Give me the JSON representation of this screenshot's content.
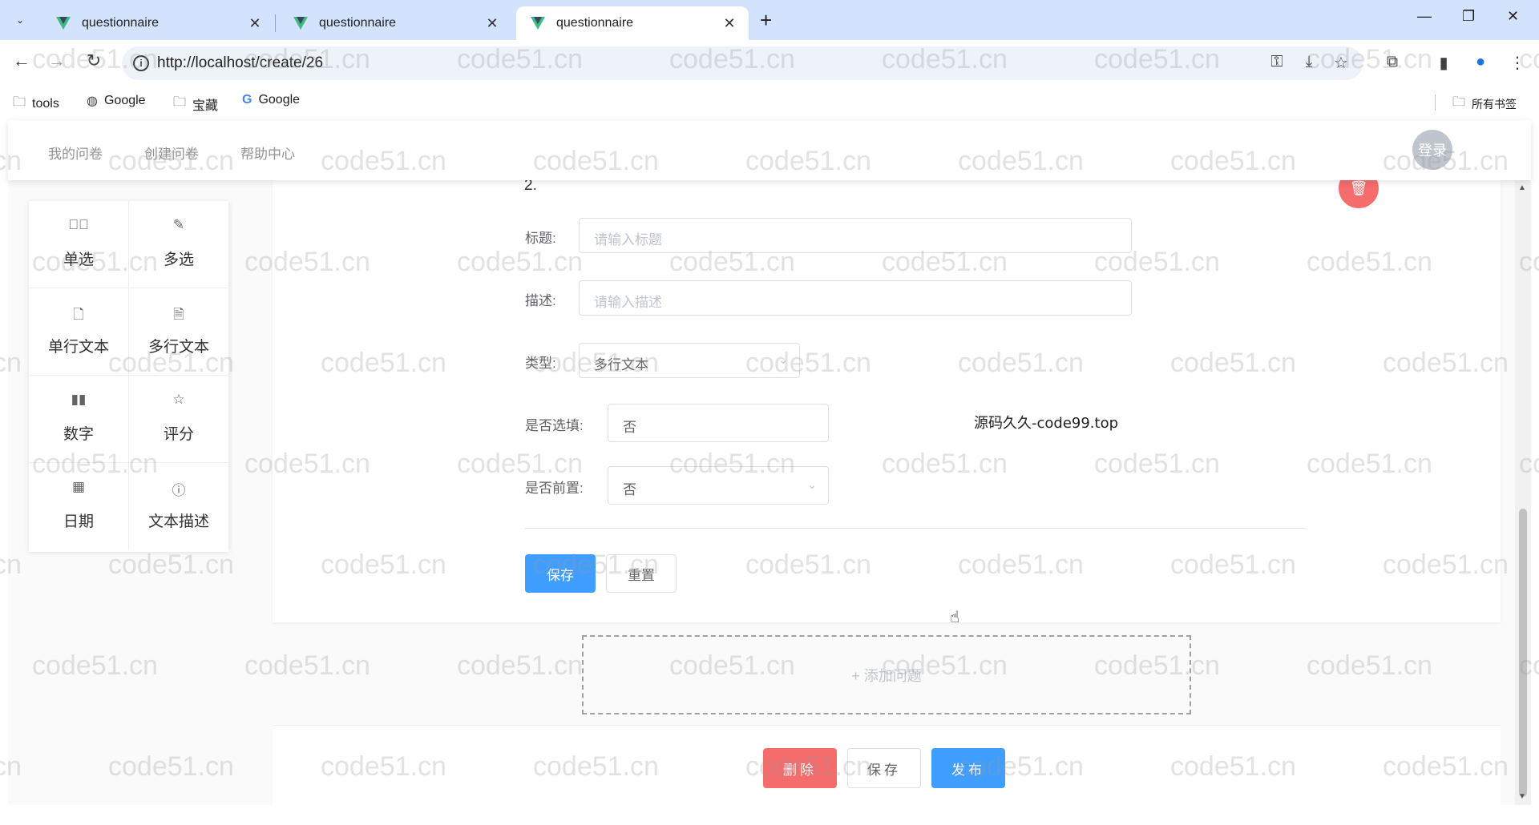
{
  "browser": {
    "tabs": [
      {
        "title": "questionnaire",
        "close": "✕"
      },
      {
        "title": "questionnaire",
        "close": "✕"
      },
      {
        "title": "questionnaire",
        "close": "✕"
      }
    ],
    "new_tab": "+",
    "url": "http://localhost/create/26",
    "bookmarks": [
      {
        "label": "tools",
        "icon": "folder-icon"
      },
      {
        "label": "Google",
        "icon": "globe-icon"
      },
      {
        "label": "宝藏",
        "icon": "folder-icon"
      },
      {
        "label": "Google",
        "icon": "google-icon"
      }
    ],
    "all_bookmarks": "所有书签"
  },
  "header": {
    "nav": [
      "我的问卷",
      "创建问卷",
      "帮助中心"
    ],
    "login": "登录"
  },
  "palette": [
    {
      "label": "单选",
      "icon": "check-circle-icon"
    },
    {
      "label": "多选",
      "icon": "edit-icon"
    },
    {
      "label": "单行文本",
      "icon": "document-icon"
    },
    {
      "label": "多行文本",
      "icon": "document-lines-icon"
    },
    {
      "label": "数字",
      "icon": "bar-chart-icon"
    },
    {
      "label": "评分",
      "icon": "star-icon"
    },
    {
      "label": "日期",
      "icon": "calendar-icon"
    },
    {
      "label": "文本描述",
      "icon": "info-circle-icon"
    }
  ],
  "question": {
    "number": "2.",
    "title_label": "标题:",
    "title_placeholder": "请输入标题",
    "desc_label": "描述:",
    "desc_placeholder": "请输入描述",
    "type_label": "类型:",
    "type_value": "多行文本",
    "optional_label": "是否选填:",
    "optional_value": "否",
    "prefix_label": "是否前置:",
    "prefix_value": "否",
    "save": "保存",
    "reset": "重置"
  },
  "overlay_text": "源码久久-code99.top",
  "add_question": "+ 添加问题",
  "footer": {
    "delete": "删除",
    "save": "保存",
    "publish": "发布"
  },
  "watermark": "code51.cn",
  "colors": {
    "primary": "#409eff",
    "danger": "#f56c6c",
    "tabbar": "#d3e3fd"
  }
}
